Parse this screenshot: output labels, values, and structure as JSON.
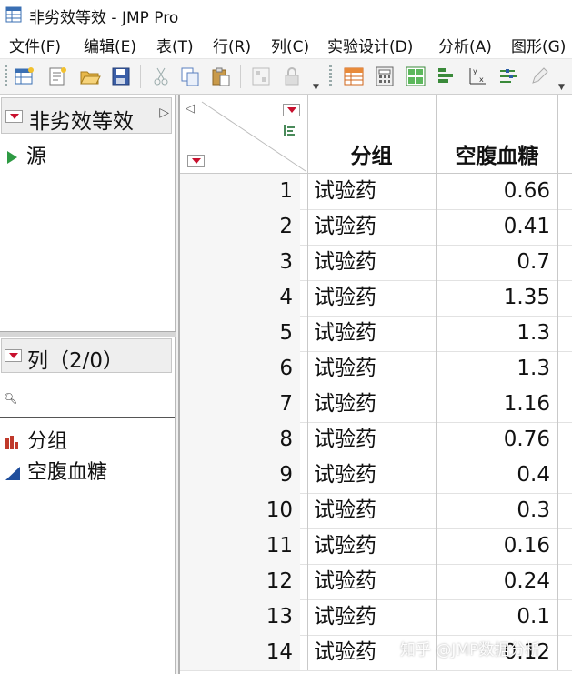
{
  "window": {
    "title": "非劣效等效 - JMP Pro"
  },
  "menu": [
    "文件(F)",
    "编辑(E)",
    "表(T)",
    "行(R)",
    "列(C)",
    "实验设计(D)",
    "分析(A)",
    "图形(G)"
  ],
  "toolbar_icons": [
    "new-table-icon",
    "new-script-icon",
    "open-icon",
    "save-icon",
    "cut-icon",
    "copy-icon",
    "paste-icon",
    "layout-icon",
    "lock-icon",
    "data-table-icon",
    "calculator-icon",
    "grid-icon",
    "distribution-icon",
    "fit-y-by-x-icon",
    "fit-model-icon",
    "edit-icon"
  ],
  "table_panel": {
    "title": "非劣效等效",
    "source": "源"
  },
  "columns_panel": {
    "title": "列（2/0）",
    "items": [
      "分组",
      "空腹血糖"
    ]
  },
  "grid": {
    "headers": [
      "分组",
      "空腹血糖"
    ],
    "rows": [
      {
        "n": "1",
        "group": "试验药",
        "value": "0.66"
      },
      {
        "n": "2",
        "group": "试验药",
        "value": "0.41"
      },
      {
        "n": "3",
        "group": "试验药",
        "value": "0.7"
      },
      {
        "n": "4",
        "group": "试验药",
        "value": "1.35"
      },
      {
        "n": "5",
        "group": "试验药",
        "value": "1.3"
      },
      {
        "n": "6",
        "group": "试验药",
        "value": "1.3"
      },
      {
        "n": "7",
        "group": "试验药",
        "value": "1.16"
      },
      {
        "n": "8",
        "group": "试验药",
        "value": "0.76"
      },
      {
        "n": "9",
        "group": "试验药",
        "value": "0.4"
      },
      {
        "n": "10",
        "group": "试验药",
        "value": "0.3"
      },
      {
        "n": "11",
        "group": "试验药",
        "value": "0.16"
      },
      {
        "n": "12",
        "group": "试验药",
        "value": "0.24"
      },
      {
        "n": "13",
        "group": "试验药",
        "value": "0.1"
      },
      {
        "n": "14",
        "group": "试验药",
        "value": "0.12"
      }
    ]
  },
  "watermark": "知乎 @JMP数据分析",
  "colors": {
    "red_triangle": "#c8102e",
    "source_green": "#2e9a43",
    "nominal_red": "#c0392b",
    "continuous_blue": "#1f4e9c"
  }
}
